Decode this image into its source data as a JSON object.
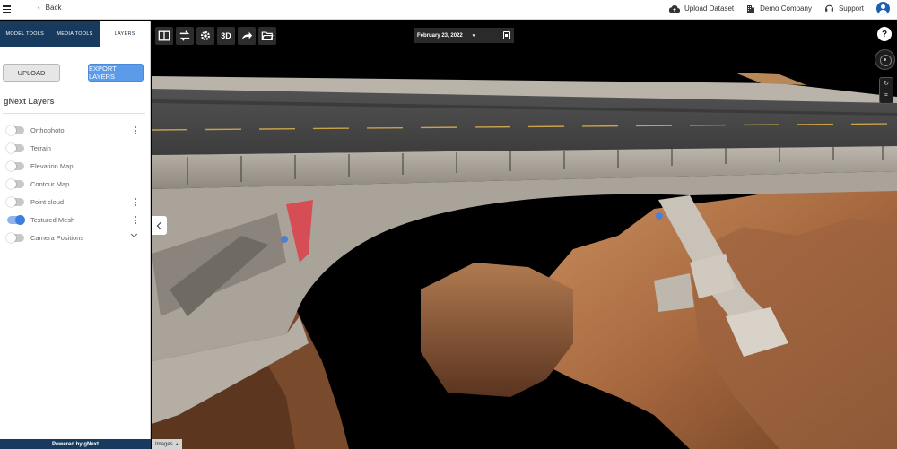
{
  "header": {
    "back_label": "Back",
    "upload_dataset_label": "Upload Dataset",
    "company_label": "Demo Company",
    "support_label": "Support"
  },
  "sidebar": {
    "tabs": [
      {
        "label": "MODEL TOOLS",
        "active": false
      },
      {
        "label": "MEDIA TOOLS",
        "active": false
      },
      {
        "label": "LAYERS",
        "active": true
      }
    ],
    "upload_label": "UPLOAD",
    "export_label": "EXPORT LAYERS",
    "section_title": "gNext Layers",
    "layers": [
      {
        "label": "Orthophoto",
        "enabled": false,
        "menu": "kebab"
      },
      {
        "label": "Terrain",
        "enabled": false,
        "menu": "none"
      },
      {
        "label": "Elevation Map",
        "enabled": false,
        "menu": "none"
      },
      {
        "label": "Contour Map",
        "enabled": false,
        "menu": "none"
      },
      {
        "label": "Point cloud",
        "enabled": false,
        "menu": "kebab"
      },
      {
        "label": "Textured Mesh",
        "enabled": true,
        "menu": "kebab"
      },
      {
        "label": "Camera Positions",
        "enabled": false,
        "menu": "chevron"
      }
    ],
    "footer": "Powered by gNext"
  },
  "viewer": {
    "toolbar": [
      {
        "icon": "split-view-icon"
      },
      {
        "icon": "swap-icon"
      },
      {
        "icon": "settings-gear-icon"
      },
      {
        "icon": "3d-toggle",
        "text": "3D"
      },
      {
        "icon": "share-arrow-icon"
      },
      {
        "icon": "folder-open-icon"
      }
    ],
    "date": "February 23, 2022",
    "help_label": "?",
    "images_tab_label": "Images"
  },
  "colors": {
    "sidebar_tab_bg": "#173a5e",
    "accent_blue": "#5b9bea",
    "toggle_on": "#3d7ee0"
  }
}
